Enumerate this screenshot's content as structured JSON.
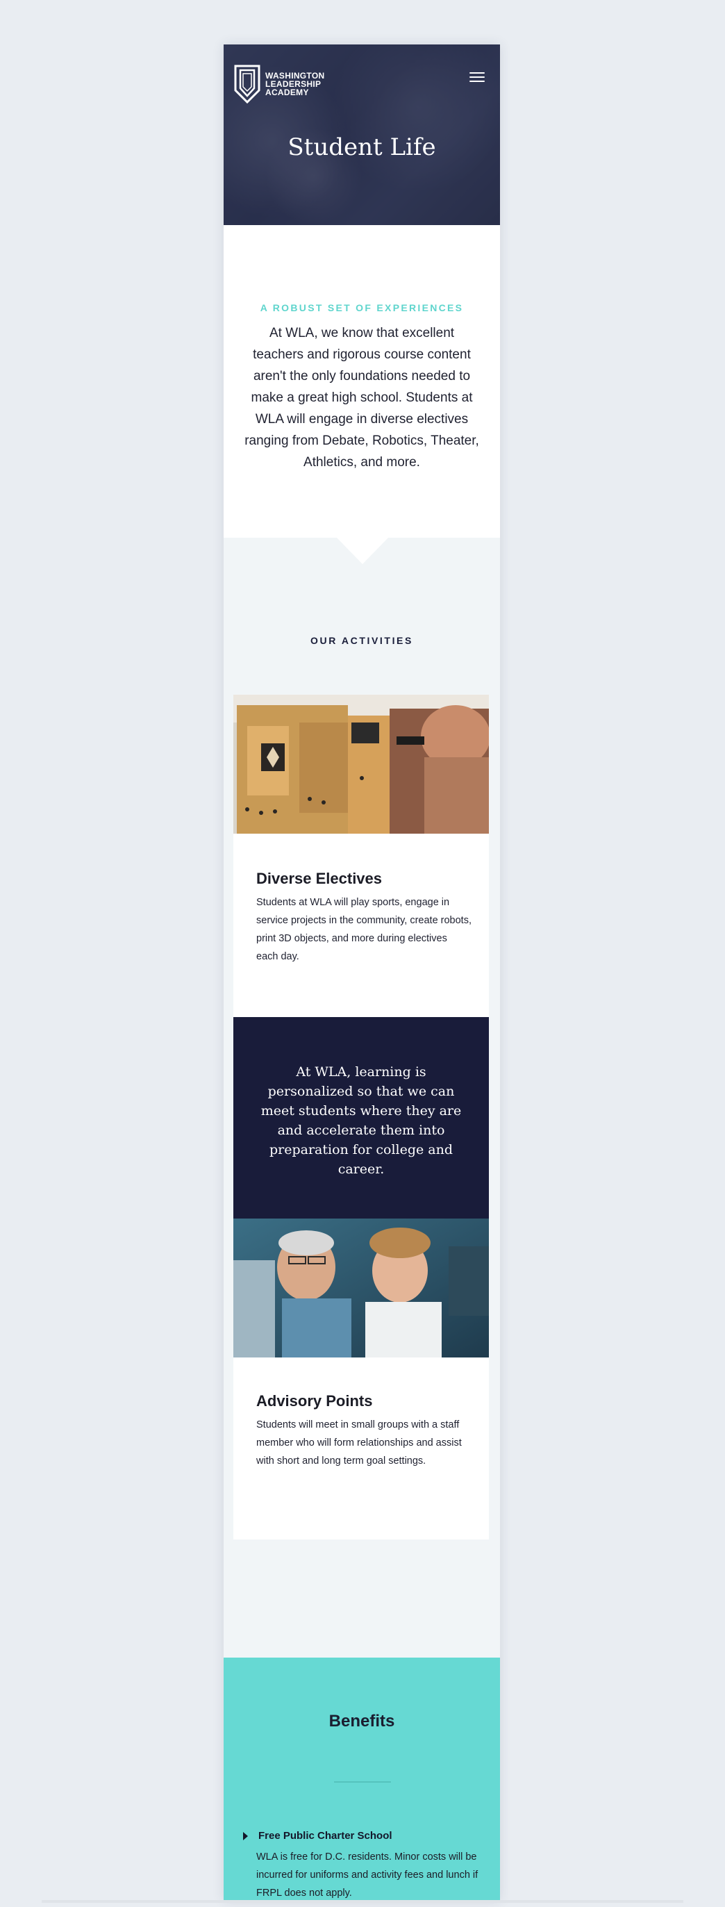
{
  "brand": {
    "name_lines": [
      "WASHINGTON",
      "LEADERSHIP",
      "ACADEMY"
    ],
    "logo_icon": "shield-logo-icon"
  },
  "header": {
    "menu_icon": "hamburger-menu-icon",
    "title": "Student Life"
  },
  "intro": {
    "eyebrow": "A ROBUST SET OF EXPERIENCES",
    "body": "At WLA, we know that excellent teachers and rigorous course content aren't the only foundations needed to make a great high school. Students at WLA will engage in diverse electives ranging from Debate, Robotics, Theater, Athletics, and more."
  },
  "activities": {
    "heading": "OUR ACTIVITIES",
    "cards": [
      {
        "title": "Diverse Electives",
        "text": "Students at WLA will play sports, engage in service projects in the community, create robots, print 3D objects, and more during electives each day.",
        "image": "3d-printer-photo"
      },
      {
        "title": "Advisory Points",
        "text": "Students will meet in small groups with a staff member who will form relationships and assist with short and long term goal settings.",
        "image": "teacher-student-photo"
      }
    ],
    "quote": "At WLA, learning is personalized so that we can meet students where they are and accelerate them into preparation for college and career."
  },
  "benefits": {
    "title": "Benefits",
    "items": [
      {
        "label": "Free Public Charter School",
        "text": "WLA is free for D.C. residents. Minor costs will be incurred for uniforms and activity fees and lunch if FRPL does not apply.",
        "icon": "caret-right-icon"
      }
    ]
  },
  "colors": {
    "navy": "#191c3a",
    "teal": "#66d9d3",
    "eyebrow_teal": "#5fd5cd",
    "page_bg": "#e9edf2",
    "section_bg": "#f1f5f7"
  }
}
